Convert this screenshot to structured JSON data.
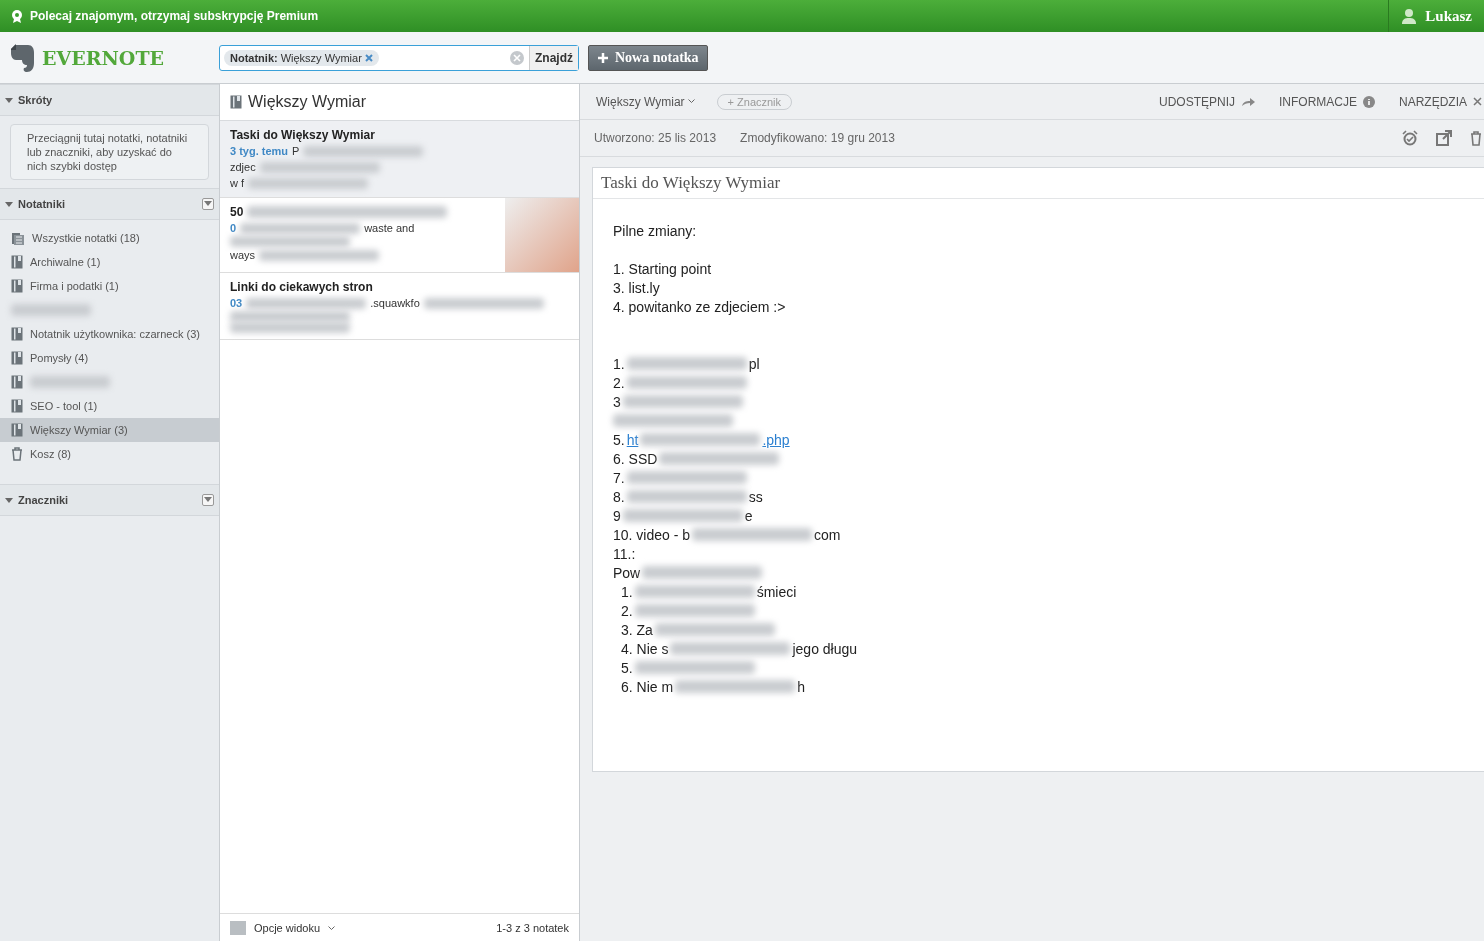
{
  "promo_bar": {
    "text": "Polecaj znajomym, otrzymaj subskrypcję Premium",
    "user": "Lukasz"
  },
  "header": {
    "logo": "EVERNOTE",
    "search": {
      "token_label": "Notatnik:",
      "token_value": "Większy Wymiar",
      "button": "Znajdź"
    },
    "new_note": "Nowa notatka"
  },
  "sidebar": {
    "shortcuts": {
      "title": "Skróty",
      "expanded": true,
      "hint": "Przeciągnij tutaj notatki, notatniki lub znaczniki, aby uzyskać do nich szybki dostęp"
    },
    "notebooks": {
      "title": "Notatniki",
      "expanded": true,
      "items": [
        {
          "kind": "all",
          "label": "Wszystkie notatki (18)",
          "selected": false
        },
        {
          "kind": "book",
          "label": "Archiwalne (1)",
          "selected": false
        },
        {
          "kind": "book",
          "label": "Firma i podatki (1)",
          "selected": false
        },
        {
          "kind": "blurred",
          "selected": false
        },
        {
          "kind": "book",
          "label": "Notatnik użytkownika: czarneck (3)",
          "selected": false
        },
        {
          "kind": "book",
          "label": "Pomysły (4)",
          "selected": false
        },
        {
          "kind": "book-blurred",
          "selected": false
        },
        {
          "kind": "book",
          "label": "SEO - tool (1)",
          "selected": false
        },
        {
          "kind": "book",
          "label": "Większy Wymiar (3)",
          "selected": true
        },
        {
          "kind": "trash",
          "label": "Kosz (8)",
          "selected": false
        }
      ]
    },
    "tags": {
      "title": "Znaczniki",
      "expanded": true
    }
  },
  "note_list": {
    "title": "Większy Wymiar",
    "notes": [
      {
        "title": "Taski do Większy Wymiar",
        "selected": true,
        "lines": [
          [
            {
              "kind": "date",
              "text": "3 tyg. temu"
            },
            {
              "kind": "text",
              "text": "P"
            },
            {
              "kind": "blur"
            }
          ],
          [
            {
              "kind": "text",
              "text": "zdjec"
            },
            {
              "kind": "blur"
            }
          ],
          [
            {
              "kind": "text",
              "text": "w f"
            },
            {
              "kind": "blur"
            }
          ]
        ]
      },
      {
        "title": "50",
        "selected": false,
        "thumbnail": true,
        "lines": [
          [
            {
              "kind": "date",
              "text": "0"
            },
            {
              "kind": "blur"
            },
            {
              "kind": "text",
              "text": "waste and"
            }
          ],
          [
            {
              "kind": "blur"
            }
          ],
          [
            {
              "kind": "text",
              "text": "ways"
            },
            {
              "kind": "blur"
            }
          ]
        ]
      },
      {
        "title": "Linki do ciekawych stron",
        "selected": false,
        "lines": [
          [
            {
              "kind": "date",
              "text": "03"
            },
            {
              "kind": "blur"
            },
            {
              "kind": "text",
              "text": ".squawkfo"
            },
            {
              "kind": "blur"
            }
          ],
          [
            {
              "kind": "blur"
            }
          ],
          [
            {
              "kind": "blur"
            }
          ]
        ]
      }
    ],
    "footer": {
      "view_options": "Opcje widoku",
      "count": "1-3 z 3 notatek"
    }
  },
  "editor": {
    "notebook": "Większy Wymiar",
    "tag_button": "+ Znacznik",
    "actions": [
      "UDOSTĘPNIJ",
      "INFORMACJE",
      "NARZĘDZIA"
    ],
    "created": "Utworzono: 25 lis 2013",
    "modified": "Zmodyfikowano: 19 gru 2013",
    "note_title": "Taski do Większy Wymiar",
    "body": [
      {
        "kind": "line",
        "segments": [
          {
            "kind": "text",
            "text": "Pilne zmiany:"
          }
        ]
      },
      {
        "kind": "gap"
      },
      {
        "kind": "line",
        "segments": [
          {
            "kind": "text",
            "text": "1. Starting point"
          }
        ]
      },
      {
        "kind": "line",
        "segments": [
          {
            "kind": "text",
            "text": "3. list.ly"
          }
        ]
      },
      {
        "kind": "line",
        "segments": [
          {
            "kind": "text",
            "text": "4. powitanko ze zdjeciem :>"
          }
        ]
      },
      {
        "kind": "gap"
      },
      {
        "kind": "gap"
      },
      {
        "kind": "line",
        "segments": [
          {
            "kind": "text",
            "text": "1."
          },
          {
            "kind": "blur"
          },
          {
            "kind": "text",
            "text": "pl"
          }
        ]
      },
      {
        "kind": "line",
        "segments": [
          {
            "kind": "text",
            "text": "2."
          },
          {
            "kind": "blur"
          }
        ]
      },
      {
        "kind": "line",
        "segments": [
          {
            "kind": "text",
            "text": "3"
          },
          {
            "kind": "blur"
          }
        ]
      },
      {
        "kind": "line",
        "segments": [
          {
            "kind": "blur"
          }
        ]
      },
      {
        "kind": "line",
        "segments": [
          {
            "kind": "text",
            "text": "5."
          },
          {
            "kind": "link",
            "text": "ht"
          },
          {
            "kind": "blur"
          },
          {
            "kind": "link",
            "text": ".php"
          }
        ]
      },
      {
        "kind": "line",
        "segments": [
          {
            "kind": "text",
            "text": "6. SSD"
          },
          {
            "kind": "blur"
          }
        ]
      },
      {
        "kind": "line",
        "segments": [
          {
            "kind": "text",
            "text": "7."
          },
          {
            "kind": "blur"
          }
        ]
      },
      {
        "kind": "line",
        "segments": [
          {
            "kind": "text",
            "text": "8."
          },
          {
            "kind": "blur"
          },
          {
            "kind": "text",
            "text": "ss"
          }
        ]
      },
      {
        "kind": "line",
        "segments": [
          {
            "kind": "text",
            "text": "9"
          },
          {
            "kind": "blur"
          },
          {
            "kind": "text",
            "text": "e"
          }
        ]
      },
      {
        "kind": "line",
        "segments": [
          {
            "kind": "text",
            "text": "10. video - b"
          },
          {
            "kind": "blur"
          },
          {
            "kind": "text",
            "text": "com"
          }
        ]
      },
      {
        "kind": "line",
        "segments": [
          {
            "kind": "text",
            "text": "11.:"
          }
        ]
      },
      {
        "kind": "line",
        "segments": [
          {
            "kind": "text",
            "text": "Pow"
          },
          {
            "kind": "blur"
          }
        ]
      },
      {
        "kind": "sub",
        "segments": [
          {
            "kind": "text",
            "text": "1."
          },
          {
            "kind": "blur"
          },
          {
            "kind": "text",
            "text": "śmieci"
          }
        ]
      },
      {
        "kind": "sub",
        "segments": [
          {
            "kind": "text",
            "text": "2."
          },
          {
            "kind": "blur"
          }
        ]
      },
      {
        "kind": "sub",
        "segments": [
          {
            "kind": "text",
            "text": "3.  Za"
          },
          {
            "kind": "blur"
          }
        ]
      },
      {
        "kind": "sub",
        "segments": [
          {
            "kind": "text",
            "text": "4.  Nie s"
          },
          {
            "kind": "blur"
          },
          {
            "kind": "text",
            "text": "jego długu"
          }
        ]
      },
      {
        "kind": "sub",
        "segments": [
          {
            "kind": "text",
            "text": "5."
          },
          {
            "kind": "blur"
          }
        ]
      },
      {
        "kind": "sub",
        "segments": [
          {
            "kind": "text",
            "text": "6.  Nie m"
          },
          {
            "kind": "blur"
          },
          {
            "kind": "text",
            "text": "h"
          }
        ]
      }
    ]
  }
}
